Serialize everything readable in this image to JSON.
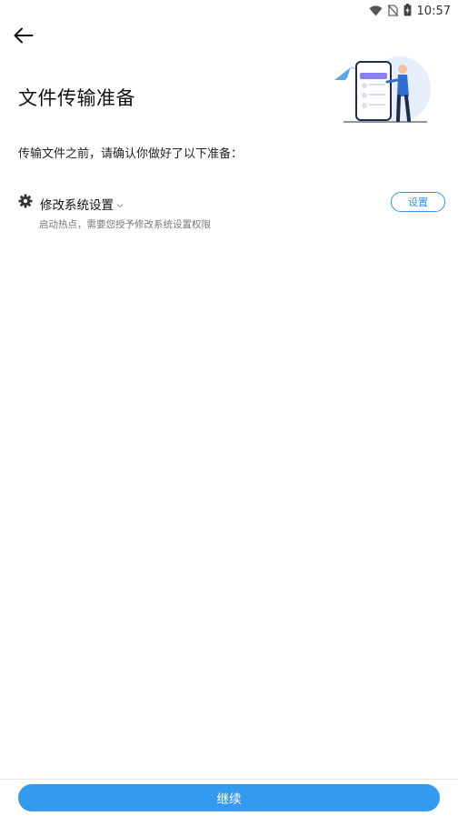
{
  "status_bar": {
    "time": "10:57",
    "icons": [
      "wifi-icon",
      "no-sim-icon",
      "battery-icon"
    ]
  },
  "header": {
    "back_icon": "arrow-left-icon",
    "title": "文件传输准备"
  },
  "main": {
    "intro": "传输文件之前，请确认你做好了以下准备：",
    "requirements": [
      {
        "icon": "gear-icon",
        "title": "修改系统设置",
        "description": "启动热点，需要您授予修改系统设置权限",
        "action_label": "设置"
      }
    ]
  },
  "footer": {
    "continue_label": "继续"
  },
  "colors": {
    "accent": "#3499f0",
    "text_primary": "#111111",
    "text_secondary": "#777777"
  }
}
